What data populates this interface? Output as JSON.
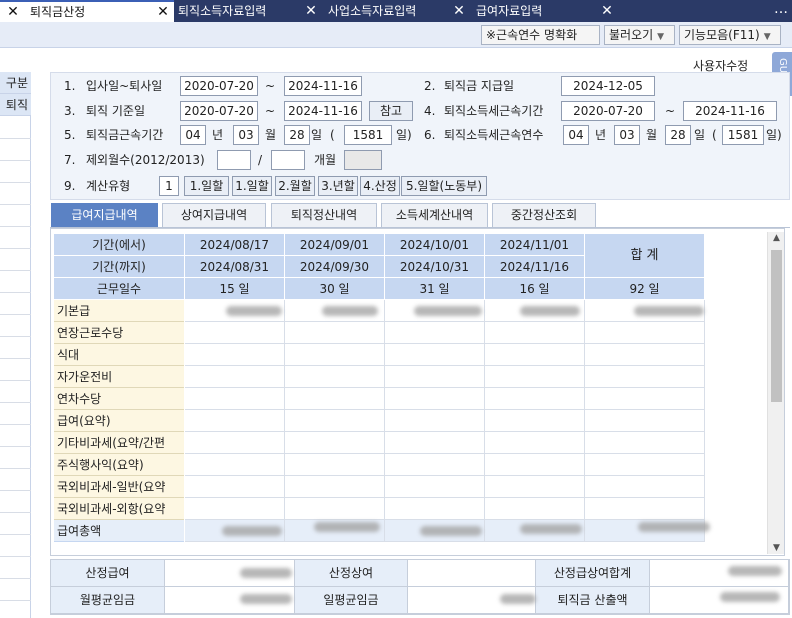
{
  "tabs": [
    {
      "label": "퇴직금산정",
      "active": true
    },
    {
      "label": "퇴직소득자료입력",
      "active": false
    },
    {
      "label": "사업소득자료입력",
      "active": false
    },
    {
      "label": "급여자료입력",
      "active": false
    }
  ],
  "more_label": "…",
  "toolbar": {
    "confirm_label": "※근속연수 명확화",
    "load_label": "불러오기",
    "functions_label": "기능모음(F11)",
    "user_modified": "사용자수정",
    "guide": "GUIDE"
  },
  "left": {
    "header": "구분",
    "item": "퇴직"
  },
  "form": {
    "r1": {
      "n": "1.",
      "label": "입사일~퇴사일",
      "from": "2020-07-20",
      "tilde": "~",
      "to": "2024-11-16",
      "n2": "2.",
      "label2": "퇴직금 지급일",
      "pay_date": "2024-12-05"
    },
    "r3": {
      "n": "3.",
      "label": "퇴직 기준일",
      "from": "2020-07-20",
      "tilde": "~",
      "to": "2024-11-16",
      "ref_btn": "참고",
      "n2": "4.",
      "label2": "퇴직소득세근속기간",
      "from2": "2020-07-20",
      "tilde2": "~",
      "to2": "2024-11-16"
    },
    "r5": {
      "n": "5.",
      "label": "퇴직금근속기간",
      "years": "04",
      "yu": "년",
      "months": "03",
      "mu": "월",
      "days": "28",
      "du": "일",
      "op": "(",
      "total_days": "1581",
      "tu": "일)",
      "n2": "6.",
      "label2": "퇴직소득세근속연수",
      "years2": "04",
      "months2": "03",
      "days2": "28",
      "total_days2": "1581"
    },
    "r7": {
      "n": "7.",
      "label": "제외월수(2012/2013)",
      "sep": "/",
      "unit": "개월"
    },
    "r9": {
      "n": "9.",
      "label": "계산유형",
      "value": "1",
      "options": [
        "1.일할",
        "1.일할",
        "2.월할",
        "3.년할",
        "4.산정",
        "5.일할(노동부)"
      ]
    }
  },
  "inner_tabs": [
    "급여지급내역",
    "상여지급내역",
    "퇴직정산내역",
    "소득세계산내역",
    "중간정산조회"
  ],
  "grid": {
    "from_label": "기간(에서)",
    "to_label": "기간(까지)",
    "days_label": "근무일수",
    "total_label": "합  계",
    "periods": [
      {
        "from": "2024/08/17",
        "to": "2024/08/31",
        "days": "15 일"
      },
      {
        "from": "2024/09/01",
        "to": "2024/09/30",
        "days": "30 일"
      },
      {
        "from": "2024/10/01",
        "to": "2024/10/31",
        "days": "31 일"
      },
      {
        "from": "2024/11/01",
        "to": "2024/11/16",
        "days": "16 일"
      }
    ],
    "total_days": "92 일",
    "rows": [
      "기본급",
      "연장근로수당",
      "식대",
      "자가운전비",
      "연차수당",
      "급여(요약)",
      "기타비과세(요약/간편",
      "주식행사익(요약)",
      "국외비과세-일반(요약",
      "국외비과세-외항(요약"
    ],
    "sum_label": "급여총액"
  },
  "summary": {
    "l1": "산정급여",
    "l2": "산정상여",
    "l3": "산정급상여합계",
    "l4": "월평균임금",
    "l5": "일평균임금",
    "l6": "퇴직금 산출액"
  }
}
